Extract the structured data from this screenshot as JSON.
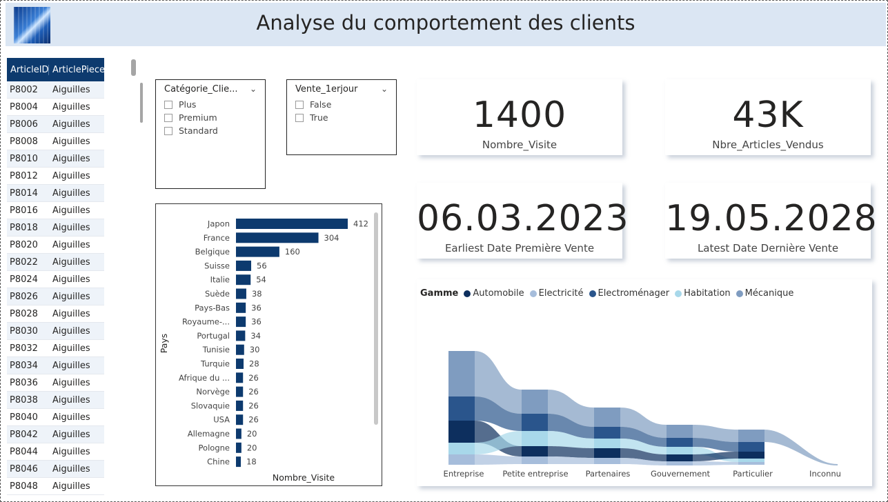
{
  "title": "Analyse du comportement des clients",
  "table": {
    "headers": [
      "ArticleID",
      "ArticlePiece"
    ],
    "rows": [
      [
        "P8002",
        "Aiguilles"
      ],
      [
        "P8004",
        "Aiguilles"
      ],
      [
        "P8006",
        "Aiguilles"
      ],
      [
        "P8008",
        "Aiguilles"
      ],
      [
        "P8010",
        "Aiguilles"
      ],
      [
        "P8012",
        "Aiguilles"
      ],
      [
        "P8014",
        "Aiguilles"
      ],
      [
        "P8016",
        "Aiguilles"
      ],
      [
        "P8018",
        "Aiguilles"
      ],
      [
        "P8020",
        "Aiguilles"
      ],
      [
        "P8022",
        "Aiguilles"
      ],
      [
        "P8024",
        "Aiguilles"
      ],
      [
        "P8026",
        "Aiguilles"
      ],
      [
        "P8028",
        "Aiguilles"
      ],
      [
        "P8030",
        "Aiguilles"
      ],
      [
        "P8032",
        "Aiguilles"
      ],
      [
        "P8034",
        "Aiguilles"
      ],
      [
        "P8036",
        "Aiguilles"
      ],
      [
        "P8038",
        "Aiguilles"
      ],
      [
        "P8040",
        "Aiguilles"
      ],
      [
        "P8042",
        "Aiguilles"
      ],
      [
        "P8044",
        "Aiguilles"
      ],
      [
        "P8046",
        "Aiguilles"
      ],
      [
        "P8048",
        "Aiguilles"
      ]
    ]
  },
  "slicer_categorie": {
    "title": "Catégorie_Clie...",
    "options": [
      "Plus",
      "Premium",
      "Standard"
    ]
  },
  "slicer_vente": {
    "title": "Vente_1erjour",
    "options": [
      "False",
      "True"
    ]
  },
  "cards": [
    {
      "value": "1400",
      "label": "Nombre_Visite"
    },
    {
      "value": "43K",
      "label": "Nbre_Articles_Vendus"
    },
    {
      "value": "06.03.2023",
      "label": "Earliest Date Première Vente"
    },
    {
      "value": "19.05.2028",
      "label": "Latest Date Dernière Vente"
    }
  ],
  "chart_data": [
    {
      "type": "bar",
      "orientation": "horizontal",
      "xlabel": "Nombre_Visite",
      "ylabel": "Pays",
      "categories": [
        "Japon",
        "France",
        "Belgique",
        "Suisse",
        "Italie",
        "Suède",
        "Pays-Bas",
        "Royaume-...",
        "Portugal",
        "Tunisie",
        "Turquie",
        "Afrique du ...",
        "Norvège",
        "Slovaquie",
        "USA",
        "Allemagne",
        "Pologne",
        "Chine"
      ],
      "values": [
        412,
        304,
        160,
        56,
        54,
        38,
        36,
        36,
        34,
        30,
        28,
        26,
        26,
        26,
        26,
        20,
        20,
        18
      ],
      "color": "#0d3a6e"
    },
    {
      "type": "ribbon",
      "legend_title": "Gamme",
      "legend": [
        {
          "name": "Automobile",
          "color": "#0d2f5e"
        },
        {
          "name": "Electricité",
          "color": "#a6bddb"
        },
        {
          "name": "Electroménager",
          "color": "#2a558c"
        },
        {
          "name": "Habitation",
          "color": "#a8d8ea"
        },
        {
          "name": "Mécanique",
          "color": "#7f9cc0"
        }
      ],
      "categories": [
        "Entreprise",
        "Petite entreprise",
        "Partenaires",
        "Gouvernement",
        "Particulier",
        "Inconnu"
      ]
    }
  ]
}
